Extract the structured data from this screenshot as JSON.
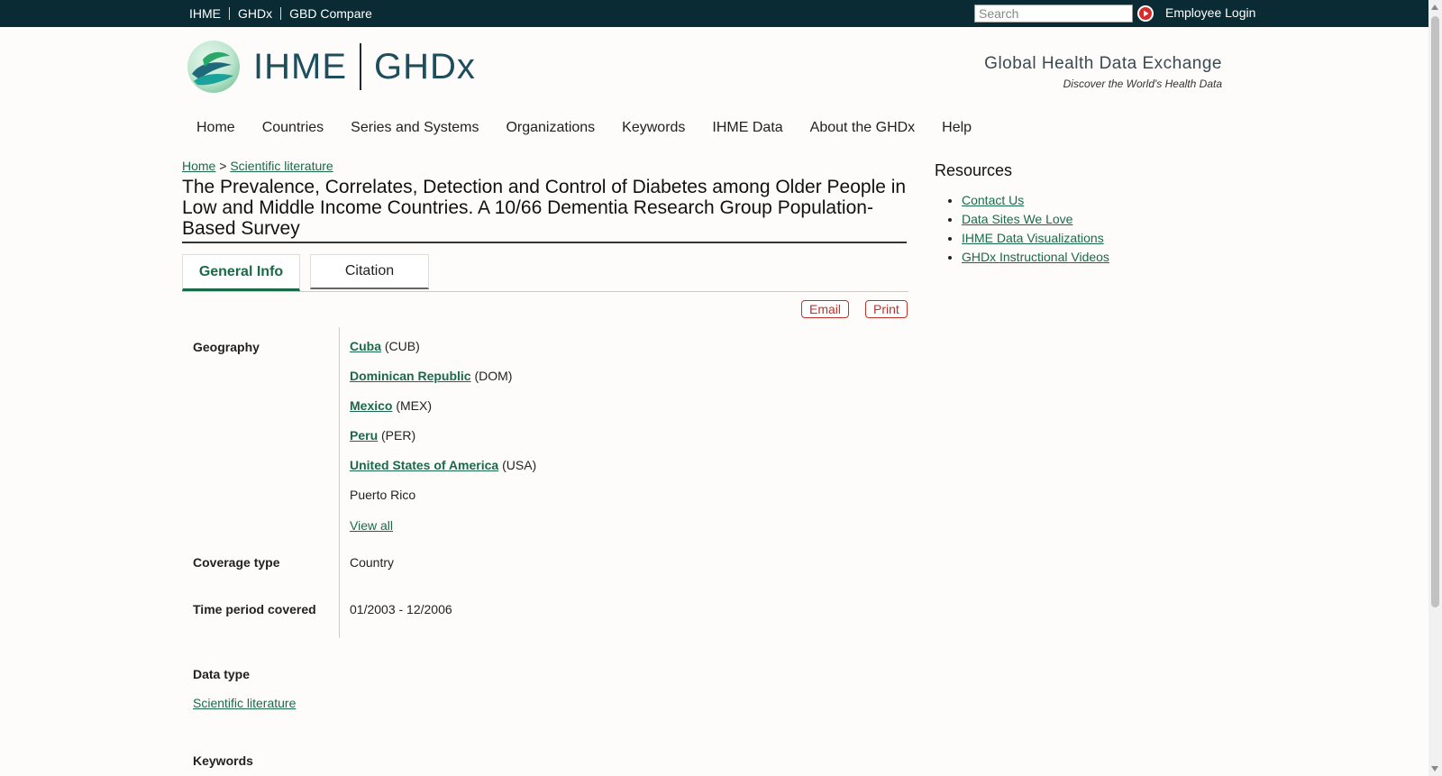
{
  "topbar": {
    "links": [
      "IHME",
      "GHDx",
      "GBD Compare"
    ],
    "search_placeholder": "Search",
    "login_label": "Employee Login"
  },
  "brand": {
    "ihme": "IHME",
    "ghdx": "GHDx",
    "tagline_title": "Global Health Data Exchange",
    "tagline_sub": "Discover the World's Health Data"
  },
  "nav": [
    "Home",
    "Countries",
    "Series and Systems",
    "Organizations",
    "Keywords",
    "IHME Data",
    "About the GHDx",
    "Help"
  ],
  "breadcrumb": {
    "home": "Home",
    "sep": ">",
    "current": "Scientific literature"
  },
  "record": {
    "title": "The Prevalence, Correlates, Detection and Control of Diabetes among Older People in Low and Middle Income Countries. A 10/66 Dementia Research Group Population-Based Survey",
    "tabs": [
      "General Info",
      "Citation"
    ],
    "actions": {
      "email": "Email",
      "print": "Print"
    },
    "geography_label": "Geography",
    "geography": [
      {
        "name": "Cuba",
        "code": "(CUB)"
      },
      {
        "name": "Dominican Republic",
        "code": "(DOM)"
      },
      {
        "name": "Mexico",
        "code": "(MEX)"
      },
      {
        "name": "Peru",
        "code": "(PER)"
      },
      {
        "name": "United States of America",
        "code": "(USA)"
      }
    ],
    "geography_extra": "Puerto Rico",
    "view_all": "View all",
    "coverage_label": "Coverage type",
    "coverage_value": "Country",
    "time_label": "Time period covered",
    "time_value": "01/2003 - 12/2006",
    "datatype_label": "Data type",
    "datatype_value": "Scientific literature",
    "keywords_label": "Keywords"
  },
  "resources": {
    "title": "Resources",
    "links": [
      "Contact Us",
      "Data Sites We Love",
      "IHME Data Visualizations",
      "GHDx Instructional Videos"
    ]
  },
  "colors": {
    "topbar": "#0a2b33",
    "link_green": "#1a6a4a",
    "action_red": "#c0302a"
  }
}
